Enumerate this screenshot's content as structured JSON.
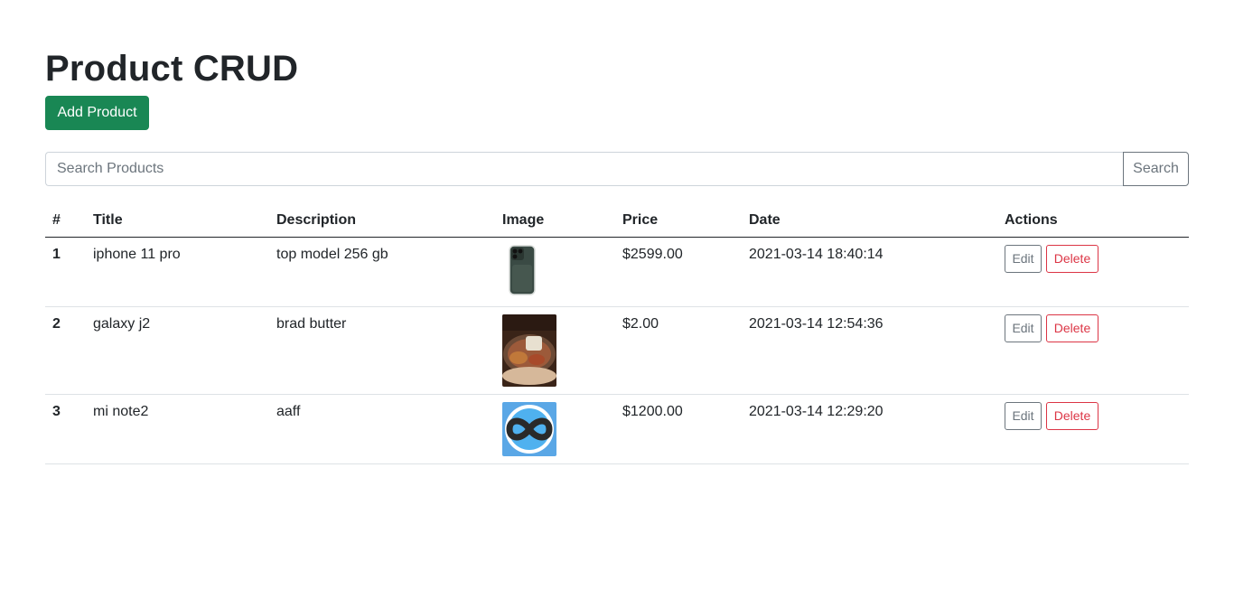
{
  "page": {
    "title": "Product CRUD"
  },
  "actions": {
    "add_label": "Add Product"
  },
  "search": {
    "placeholder": "Search Products",
    "value": "",
    "button_label": "Search"
  },
  "table": {
    "headers": [
      "#",
      "Title",
      "Description",
      "Image",
      "Price",
      "Date",
      "Actions"
    ],
    "rows": [
      {
        "num": "1",
        "title": "iphone 11 pro",
        "description": "top model 256 gb",
        "image": "phone-image",
        "price": "$2599.00",
        "date": "2021-03-14 18:40:14",
        "edit": "Edit",
        "delete": "Delete"
      },
      {
        "num": "2",
        "title": "galaxy j2",
        "description": "brad butter",
        "image": "food-plate-image",
        "price": "$2.00",
        "date": "2021-03-14 12:54:36",
        "edit": "Edit",
        "delete": "Delete"
      },
      {
        "num": "3",
        "title": "mi note2",
        "description": "aaff",
        "image": "infinity-logo-image",
        "price": "$1200.00",
        "date": "2021-03-14 12:29:20",
        "edit": "Edit",
        "delete": "Delete"
      }
    ]
  },
  "colors": {
    "primary_success": "#198754",
    "danger": "#dc3545",
    "secondary": "#6c757d"
  }
}
